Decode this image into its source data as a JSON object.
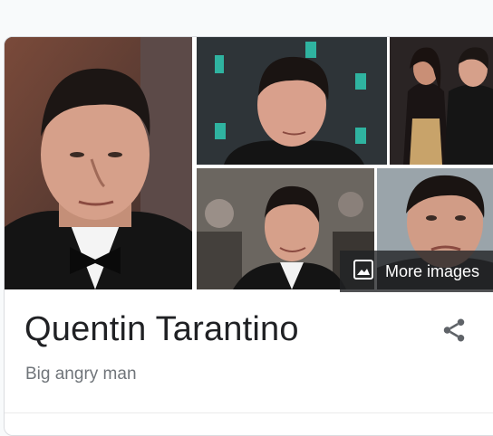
{
  "knowledge_panel": {
    "title": "Quentin Tarantino",
    "subtitle": "Big angry man",
    "more_images_label": "More images",
    "share_icon": "share-icon",
    "more_images_icon": "image-icon"
  },
  "colors": {
    "title": "#202124",
    "subtitle": "#70757a",
    "overlay": "#202124",
    "share_icon": "#5f6368"
  }
}
